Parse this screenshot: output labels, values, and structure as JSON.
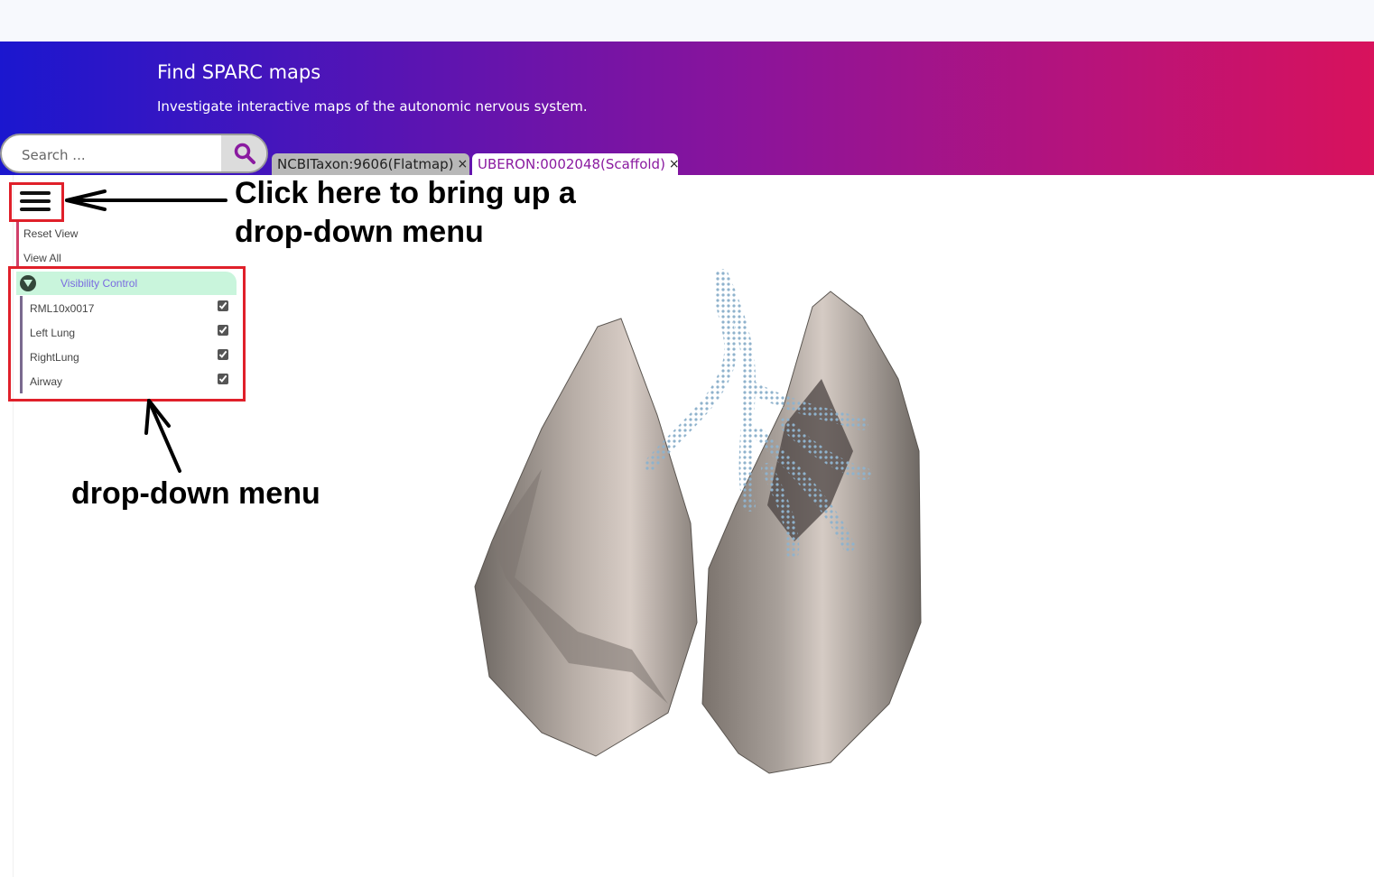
{
  "banner": {
    "title": "Find SPARC maps",
    "subtitle": "Investigate interactive maps of the autonomic nervous system."
  },
  "search": {
    "placeholder": "Search ..."
  },
  "tabs": [
    {
      "label": "NCBITaxon:9606(Flatmap)",
      "close": "×",
      "active": false
    },
    {
      "label": "UBERON:0002048(Scaffold)",
      "close": "×",
      "active": true
    }
  ],
  "menu": {
    "reset_view": "Reset View",
    "view_all": "View All",
    "visibility_control": "Visibility Control",
    "items": [
      {
        "label": "RML10x0017",
        "checked": true
      },
      {
        "label": "Left Lung",
        "checked": true
      },
      {
        "label": "RightLung",
        "checked": true
      },
      {
        "label": "Airway",
        "checked": true
      }
    ]
  },
  "annotations": {
    "hamburger_callout": [
      "Click here to bring up a",
      "drop-down menu"
    ],
    "menu_callout": "drop-down menu"
  },
  "colors": {
    "banner_start": "#1b17cf",
    "banner_end": "#d8125c",
    "active_tab_text": "#8a1aa0",
    "highlight_box": "#e0202a",
    "visibility_header_bg": "#c9f5dc"
  }
}
